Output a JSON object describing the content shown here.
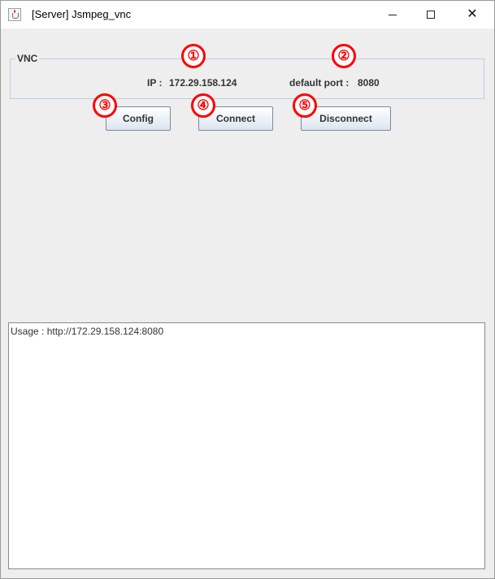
{
  "window": {
    "title": "[Server] Jsmpeg_vnc",
    "icon": "java-cup-icon",
    "controls": [
      "minimize-icon",
      "maximize-icon",
      "close-icon"
    ]
  },
  "vnc_panel": {
    "legend": "VNC",
    "ip_label": "IP :",
    "ip_value": "172.29.158.124",
    "port_label": "default port :",
    "port_value": "8080"
  },
  "buttons": {
    "config": "Config",
    "connect": "Connect",
    "disconnect": "Disconnect"
  },
  "annotations": [
    "①",
    "②",
    "③",
    "④",
    "⑤"
  ],
  "annotation_color": "#ff0000",
  "output": {
    "text": "Usage : http://172.29.158.124:8080"
  }
}
